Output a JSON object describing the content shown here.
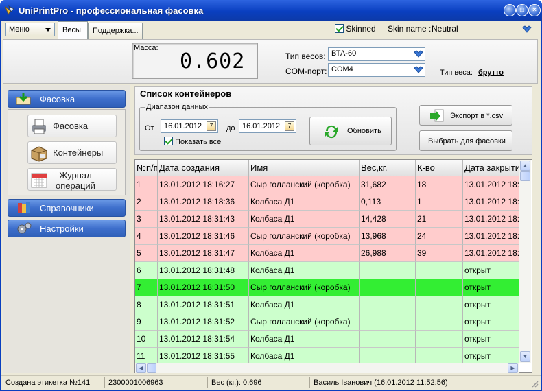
{
  "window": {
    "title": "UniPrintPro - профессиональная фасовка"
  },
  "toolbar": {
    "menu_label": "Меню",
    "tabs": [
      {
        "label": "Весы"
      },
      {
        "label": "Поддержка..."
      }
    ],
    "skinned_label": "Skinned",
    "skinned_checked": true,
    "skin_name_label": "Skin name :",
    "skin_name_value": "Neutral"
  },
  "scale": {
    "mass_label": "Масса:",
    "mass_value": "0.602",
    "scale_type_label": "Тип весов:",
    "scale_type_value": "ВТА-60",
    "com_port_label": "COM-порт:",
    "com_port_value": "COM4",
    "weight_type_label": "Тип веса:",
    "weight_type_value": "брутто"
  },
  "sidebar": {
    "sections": [
      {
        "label": "Фасовка",
        "icon": "download-arrow-icon"
      },
      {
        "label": "Справочники",
        "icon": "books-icon"
      },
      {
        "label": "Настройки",
        "icon": "gears-icon"
      }
    ],
    "items": [
      {
        "label": "Фасовка",
        "icon": "printer-icon"
      },
      {
        "label": "Контейнеры",
        "icon": "box-icon"
      },
      {
        "label": "Журнал операций",
        "line1": "Журнал",
        "line2": "операций",
        "icon": "calendar-icon"
      }
    ]
  },
  "containers": {
    "title": "Список контейнеров",
    "range_label": "Диапазон данных",
    "from_label": "От",
    "from_date": "16.01.2012",
    "to_label": "до",
    "to_date": "16.01.2012",
    "show_all_label": "Показать все",
    "show_all_checked": true,
    "refresh_label": "Обновить",
    "export_label": "Экспорт в *.csv",
    "select_label": "Выбрать для фасовки"
  },
  "table": {
    "columns": [
      "№п/п",
      "Дата создания",
      "Имя",
      "Вес,кг.",
      "К-во",
      "Дата закрытия"
    ],
    "rows": [
      {
        "n": "1",
        "date": "13.01.2012 18:16:27",
        "name": "Сыр голланский (коробка)",
        "weight": "31,682",
        "qty": "18",
        "closed": "13.01.2012 18:",
        "status": "closed"
      },
      {
        "n": "2",
        "date": "13.01.2012 18:18:36",
        "name": "Колбаса Д1",
        "weight": "0,113",
        "qty": "1",
        "closed": "13.01.2012 18:",
        "status": "closed"
      },
      {
        "n": "3",
        "date": "13.01.2012 18:31:43",
        "name": "Колбаса Д1",
        "weight": "14,428",
        "qty": "21",
        "closed": "13.01.2012 18:",
        "status": "closed"
      },
      {
        "n": "4",
        "date": "13.01.2012 18:31:46",
        "name": "Сыр голланский (коробка)",
        "weight": "13,968",
        "qty": "24",
        "closed": "13.01.2012 18:",
        "status": "closed"
      },
      {
        "n": "5",
        "date": "13.01.2012 18:31:47",
        "name": "Колбаса Д1",
        "weight": "26,988",
        "qty": "39",
        "closed": "13.01.2012 18:",
        "status": "closed"
      },
      {
        "n": "6",
        "date": "13.01.2012 18:31:48",
        "name": "Колбаса Д1",
        "weight": "",
        "qty": "",
        "closed": "открыт",
        "status": "open"
      },
      {
        "n": "7",
        "date": "13.01.2012 18:31:50",
        "name": "Сыр голланский (коробка)",
        "weight": "",
        "qty": "",
        "closed": "открыт",
        "status": "selected"
      },
      {
        "n": "8",
        "date": "13.01.2012 18:31:51",
        "name": "Колбаса Д1",
        "weight": "",
        "qty": "",
        "closed": "открыт",
        "status": "open"
      },
      {
        "n": "9",
        "date": "13.01.2012 18:31:52",
        "name": "Сыр голланский (коробка)",
        "weight": "",
        "qty": "",
        "closed": "открыт",
        "status": "open"
      },
      {
        "n": "10",
        "date": "13.01.2012 18:31:54",
        "name": "Колбаса Д1",
        "weight": "",
        "qty": "",
        "closed": "открыт",
        "status": "open"
      },
      {
        "n": "11",
        "date": "13.01.2012 18:31:55",
        "name": "Колбаса Д1",
        "weight": "",
        "qty": "",
        "closed": "открыт",
        "status": "open"
      }
    ]
  },
  "colors": {
    "closed": "#ffcccc",
    "open": "#ccffcc",
    "selected": "#33ee33",
    "accent": "#3e6fcc"
  },
  "statusbar": {
    "label_created": "Создана этикетка №141",
    "barcode": "2300001006963",
    "weight": "Вес (кг.): 0.696",
    "user": "Василь Іванович (16.01.2012 11:52:56)"
  }
}
